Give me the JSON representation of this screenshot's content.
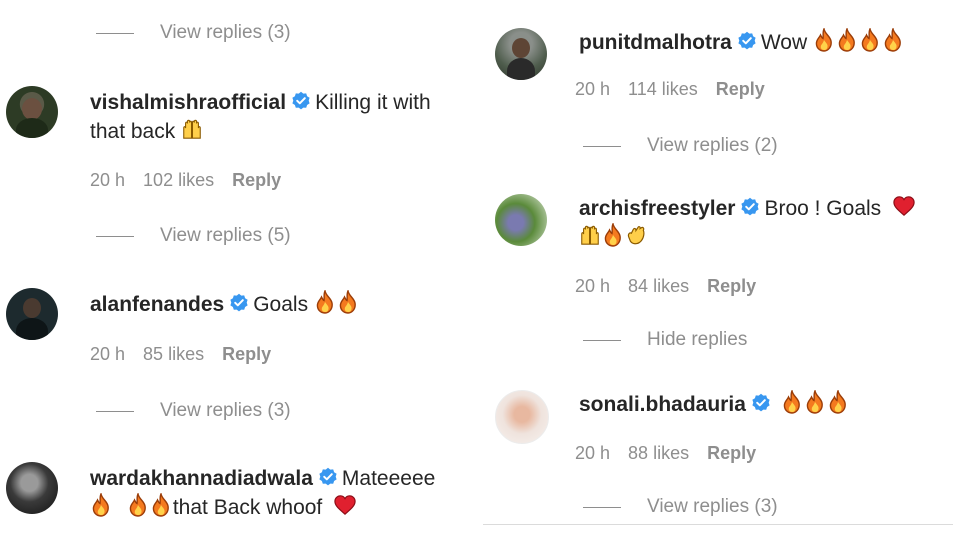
{
  "left": {
    "top_view_replies": "View replies (3)",
    "comments": [
      {
        "username": "vishalmishraofficial",
        "text_1": "Killing it with",
        "text_2": "that back",
        "time": "20 h",
        "likes": "102 likes",
        "reply": "Reply",
        "view_replies": "View replies (5)"
      },
      {
        "username": "alanfenandes",
        "text": "Goals",
        "time": "20 h",
        "likes": "85 likes",
        "reply": "Reply",
        "view_replies": "View replies (3)"
      },
      {
        "username": "wardakhannadiadwala",
        "text_1": "Mateeeee",
        "text_2": "that Back whoof"
      }
    ]
  },
  "right": {
    "comments": [
      {
        "username": "punitdmalhotra",
        "text": "Wow",
        "time": "20 h",
        "likes": "114 likes",
        "reply": "Reply",
        "view_replies": "View replies (2)"
      },
      {
        "username": "archisfreestyler",
        "text": "Broo ! Goals",
        "time": "20 h",
        "likes": "84 likes",
        "reply": "Reply",
        "hide_replies": "Hide replies"
      },
      {
        "username": "sonali.bhadauria",
        "time": "20 h",
        "likes": "88 likes",
        "reply": "Reply",
        "view_replies": "View replies (3)"
      }
    ]
  },
  "colors": {
    "badge_blue": "#3897f0",
    "muted_text": "#8e8e8e",
    "text": "#262626",
    "heart_red": "#e0202f",
    "fire_orange": "#f47a1f"
  },
  "icons": [
    "verified-badge-icon",
    "fire-emoji-icon",
    "raising-hands-emoji-icon",
    "clapping-hands-emoji-icon",
    "red-heart-emoji-icon"
  ]
}
